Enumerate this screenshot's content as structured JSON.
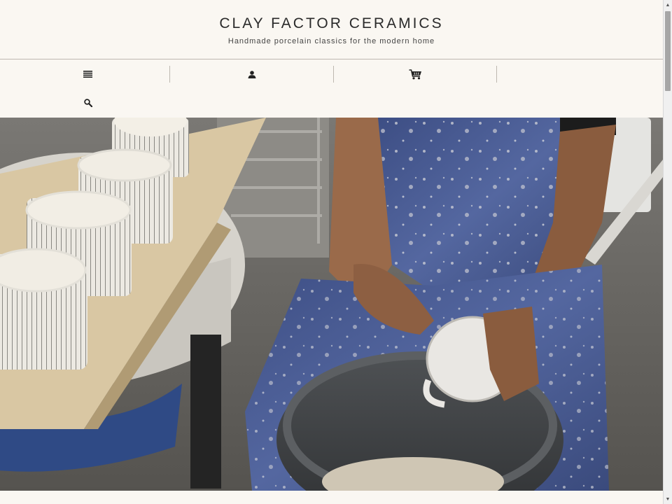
{
  "header": {
    "brand": "CLAY FACTOR CERAMICS",
    "tagline": "Handmade porcelain classics for the modern home"
  },
  "nav": {
    "items": [
      {
        "icon": "menu-icon"
      },
      {
        "icon": "account-icon"
      },
      {
        "icon": "cart-icon"
      },
      {
        "icon": ""
      },
      {
        "icon": "search-icon"
      }
    ]
  },
  "hero": {
    "image": "photo of a potter trimming a striped porcelain mug over a slip bucket, with finished mugs drying on a board beside the wheel"
  },
  "colors": {
    "background": "#faf7f2",
    "text": "#2b2b2b",
    "divider": "#bdb8b0"
  }
}
